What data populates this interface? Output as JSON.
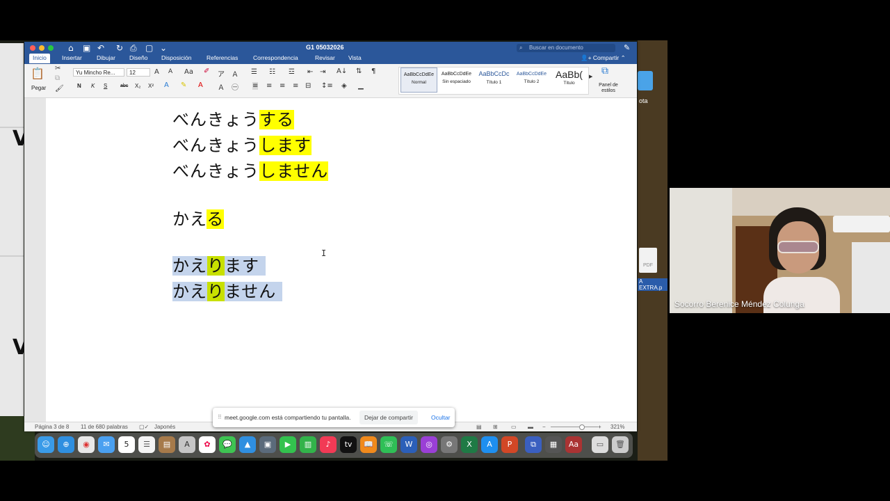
{
  "window": {
    "doc_title": "G1 05032026",
    "search_placeholder": "Buscar en documento",
    "share_label": "Compartir"
  },
  "tabs": [
    "Inicio",
    "Insertar",
    "Dibujar",
    "Diseño",
    "Disposición",
    "Referencias",
    "Correspondencia",
    "Revisar",
    "Vista"
  ],
  "ribbon": {
    "paste_label": "Pegar",
    "font_name": "Yu Mincho Re...",
    "font_size": "12",
    "bold": "N",
    "italic": "K",
    "underline": "S",
    "strike": "abc",
    "subscript": "X₂",
    "superscript": "X²",
    "styles_pane_label": "Panel de estilos",
    "styles": [
      {
        "preview": "AaBbCcDdEe",
        "name": "Normal"
      },
      {
        "preview": "AaBbCcDdEe",
        "name": "Sin espaciado"
      },
      {
        "preview": "AaBbCcDc",
        "name": "Título 1"
      },
      {
        "preview": "AaBbCcDdEe",
        "name": "Título 2"
      },
      {
        "preview": "AaBb(",
        "name": "Título"
      }
    ]
  },
  "document": {
    "line1_base": "べんきょう",
    "line1_end": "する",
    "line2_base": "べんきょう",
    "line2_end": "します",
    "line3_base": "べんきょう",
    "line3_end": "しません",
    "line4_base": "かえ",
    "line4_end": "る",
    "line5_a": "かえ",
    "line5_b": "り",
    "line5_c": "ます",
    "line6_a": "かえ",
    "line6_b": "り",
    "line6_c": "ません"
  },
  "statusbar": {
    "page": "Página 3 de 8",
    "words": "11 de 680 palabras",
    "language": "Japonés",
    "zoom": "321%"
  },
  "notice": {
    "message": "meet.google.com está compartiendo tu pantalla.",
    "stop_label": "Dejar de compartir",
    "hide_label": "Ocultar"
  },
  "desktop": {
    "nota_label": "ota",
    "pdf_label": "PDF",
    "file_label": "A EXTRA.p",
    "left_glyph": "V"
  },
  "dock": {
    "calendar_day": "5",
    "dictionary_label": "Aa"
  },
  "participant": {
    "name": "Socorro Berenice Méndez Colunga"
  },
  "colors": {
    "word_blue": "#2b579a",
    "highlight_yellow": "#ffff00",
    "selection_blue": "#c4d4ec",
    "link_blue": "#1a73e8"
  }
}
